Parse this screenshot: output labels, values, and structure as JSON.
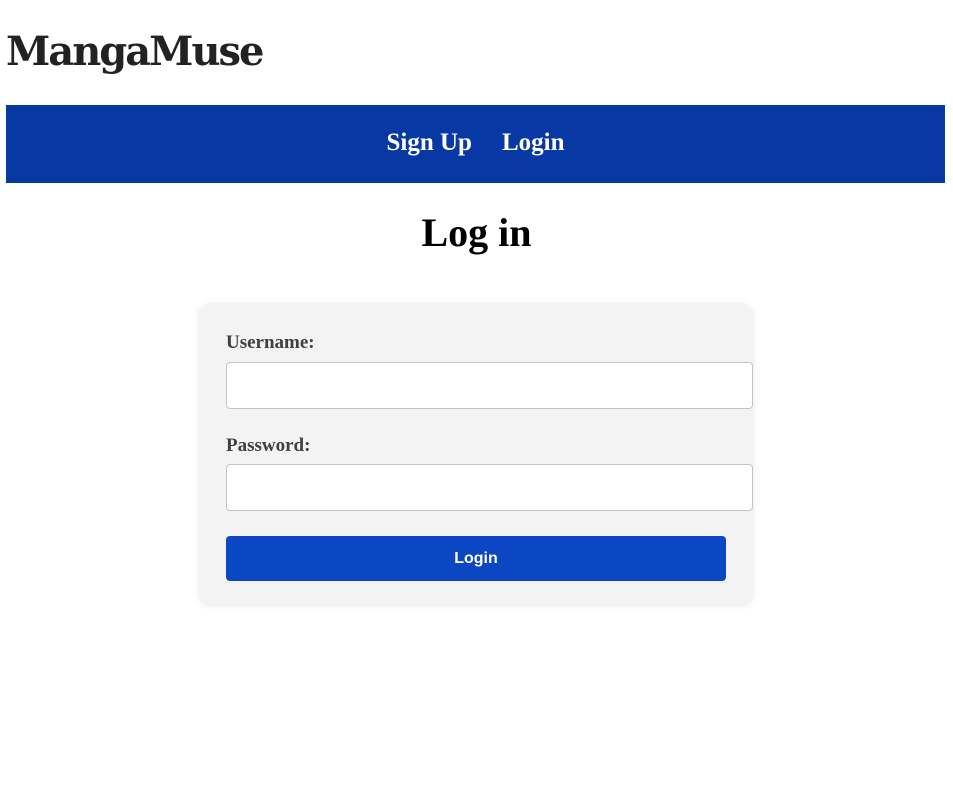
{
  "site": {
    "title": "MangaMuse"
  },
  "nav": {
    "items": [
      {
        "label": "Sign Up"
      },
      {
        "label": "Login"
      }
    ]
  },
  "page": {
    "heading": "Log in"
  },
  "form": {
    "username_label": "Username:",
    "username_value": "",
    "password_label": "Password:",
    "password_value": "",
    "submit_label": "Login"
  },
  "colors": {
    "nav_background": "#0838a3",
    "button_background": "#0c47c3",
    "card_background": "#f3f3f3"
  }
}
